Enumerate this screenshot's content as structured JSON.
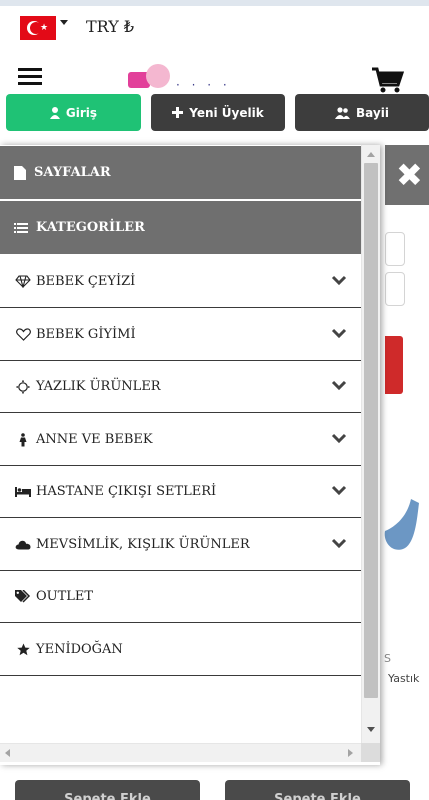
{
  "topbar": {
    "flag_icon": "turkey-flag-icon",
    "currency": "TRY ₺"
  },
  "header": {
    "menu_icon": "hamburger-icon",
    "logo_icon": "baby-store-logo",
    "cart_icon": "shopping-cart-icon"
  },
  "auth": {
    "login_label": "Giriş",
    "register_label": "Yeni Üyelik",
    "dealer_label": "Bayii",
    "login_color": "#1fc275",
    "dark_color": "#3d3d3d"
  },
  "drawer": {
    "pages_title": "SAYFALAR",
    "categories_title": "KATEGORİLER",
    "items": [
      {
        "label": "BEBEK ÇEYİZİ",
        "icon": "diamond-icon",
        "has_submenu": true
      },
      {
        "label": "BEBEK GİYİMİ",
        "icon": "heart-icon",
        "has_submenu": true
      },
      {
        "label": "YAZLIK ÜRÜNLER",
        "icon": "sun-icon",
        "has_submenu": true
      },
      {
        "label": "ANNE VE BEBEK",
        "icon": "child-icon",
        "has_submenu": true
      },
      {
        "label": "HASTANE ÇIKIŞI SETLERİ",
        "icon": "bed-icon",
        "has_submenu": true
      },
      {
        "label": "MEVSİMLİK, KIŞLIK ÜRÜNLER",
        "icon": "cloud-icon",
        "has_submenu": true
      },
      {
        "label": "OUTLET",
        "icon": "tags-icon",
        "has_submenu": false
      },
      {
        "label": "YENİDOĞAN",
        "icon": "star-icon",
        "has_submenu": false
      }
    ],
    "header_color": "#6f6f6f"
  },
  "background": {
    "close_icon": "close-icon",
    "partial_text": "Yastık",
    "partial_text2": "S",
    "add_to_cart_1": "Sepete Ekle",
    "add_to_cart_2": "Sepete Ekle"
  }
}
